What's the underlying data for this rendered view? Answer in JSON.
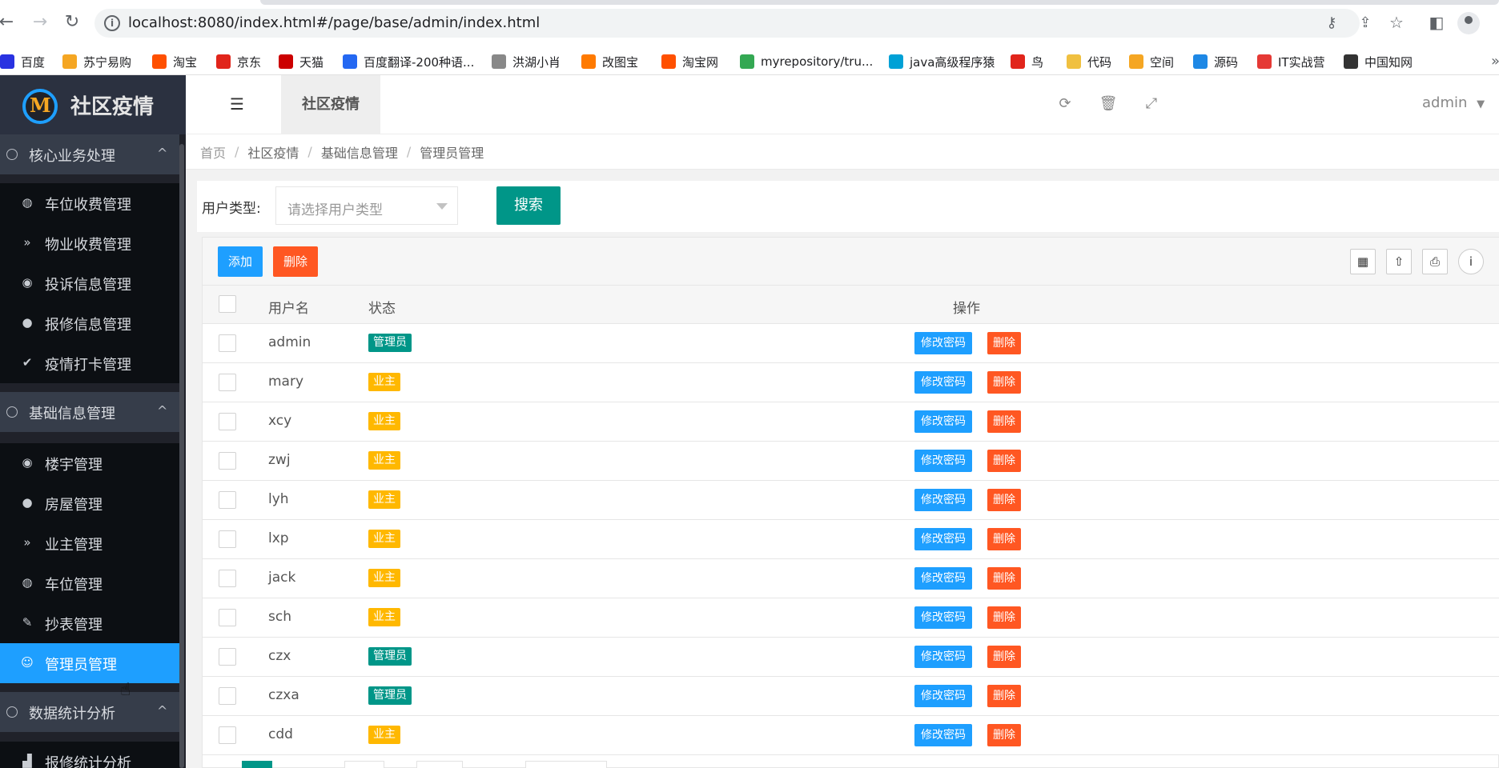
{
  "browser": {
    "url": "localhost:8080/index.html#/page/base/admin/index.html",
    "bookmarks": [
      {
        "label": "百度",
        "icon": "baidu-paw-icon",
        "color": "#2932e1"
      },
      {
        "label": "苏宁易购",
        "icon": "suning-lion-icon",
        "color": "#f5a623"
      },
      {
        "label": "淘宝",
        "icon": "taobao-icon",
        "color": "#ff5000"
      },
      {
        "label": "京东",
        "icon": "jd-icon",
        "color": "#e1251b"
      },
      {
        "label": "天猫",
        "icon": "tmall-icon",
        "color": "#cc0000"
      },
      {
        "label": "百度翻译-200种语...",
        "icon": "baidu-translate-icon",
        "color": "#2468f2"
      },
      {
        "label": "洪湖小肖",
        "icon": "bird-icon",
        "color": "#888888"
      },
      {
        "label": "改图宝",
        "icon": "gaitubao-icon",
        "color": "#ff7a00"
      },
      {
        "label": "淘宝网",
        "icon": "taobao-net-icon",
        "color": "#ff5000"
      },
      {
        "label": "myrepository/tru...",
        "icon": "chrome-site-icon",
        "color": "#34a853"
      },
      {
        "label": "java高级程序猿",
        "icon": "bilibili-icon",
        "color": "#00a1d6"
      },
      {
        "label": "鸟",
        "icon": "bird-red-icon",
        "color": "#e1251b"
      },
      {
        "label": "代码",
        "icon": "code-icon",
        "color": "#f0c040"
      },
      {
        "label": "空间",
        "icon": "qzone-icon",
        "color": "#f5a623"
      },
      {
        "label": "源码",
        "icon": "source-fish-icon",
        "color": "#1e88e5"
      },
      {
        "label": "IT实战营",
        "icon": "it-camp-icon",
        "color": "#e53935"
      },
      {
        "label": "中国知网",
        "icon": "cnki-icon",
        "color": "#333333"
      }
    ]
  },
  "app": {
    "logo_text": "社区疫情",
    "top_tab": "社区疫情",
    "user": "admin"
  },
  "sidebar": {
    "groups": [
      {
        "label": "核心业务处理",
        "chevron": "^"
      },
      {
        "label": "基础信息管理",
        "chevron": "^"
      },
      {
        "label": "数据统计分析",
        "chevron": "^"
      }
    ],
    "items": [
      {
        "label": "车位收费管理",
        "icon": "dashboard-icon",
        "glyph": "◍"
      },
      {
        "label": "物业收费管理",
        "icon": "double-chevron-down-icon",
        "glyph": "»"
      },
      {
        "label": "投诉信息管理",
        "icon": "target-icon",
        "glyph": "◉"
      },
      {
        "label": "报修信息管理",
        "icon": "repair-icon",
        "glyph": "●"
      },
      {
        "label": "疫情打卡管理",
        "icon": "check-icon",
        "glyph": "✔"
      },
      {
        "label": "楼宇管理",
        "icon": "target-icon",
        "glyph": "◉"
      },
      {
        "label": "房屋管理",
        "icon": "house-icon",
        "glyph": "●"
      },
      {
        "label": "业主管理",
        "icon": "double-chevron-down-icon",
        "glyph": "»"
      },
      {
        "label": "车位管理",
        "icon": "dashboard-icon",
        "glyph": "◍"
      },
      {
        "label": "抄表管理",
        "icon": "edit-icon",
        "glyph": "✎"
      },
      {
        "label": "管理员管理",
        "icon": "user-circle-icon",
        "glyph": "☺"
      },
      {
        "label": "报修统计分析",
        "icon": "chart-icon",
        "glyph": "▟"
      }
    ]
  },
  "breadcrumb": [
    "首页",
    "社区疫情",
    "基础信息管理",
    "管理员管理"
  ],
  "search": {
    "label": "用户类型:",
    "placeholder": "请选择用户类型",
    "button": "搜索"
  },
  "toolbar": {
    "add": "添加",
    "delete": "删除"
  },
  "table": {
    "headers": {
      "username": "用户名",
      "status": "状态",
      "actions": "操作"
    },
    "action_labels": {
      "change_password": "修改密码",
      "delete": "删除"
    },
    "rows": [
      {
        "username": "admin",
        "status": "管理员",
        "type": "admin"
      },
      {
        "username": "mary",
        "status": "业主",
        "type": "owner"
      },
      {
        "username": "xcy",
        "status": "业主",
        "type": "owner"
      },
      {
        "username": "zwj",
        "status": "业主",
        "type": "owner"
      },
      {
        "username": "lyh",
        "status": "业主",
        "type": "owner"
      },
      {
        "username": "lxp",
        "status": "业主",
        "type": "owner"
      },
      {
        "username": "jack",
        "status": "业主",
        "type": "owner"
      },
      {
        "username": "sch",
        "status": "业主",
        "type": "owner"
      },
      {
        "username": "czx",
        "status": "管理员",
        "type": "admin"
      },
      {
        "username": "czxa",
        "status": "管理员",
        "type": "admin"
      },
      {
        "username": "cdd",
        "status": "业主",
        "type": "owner"
      }
    ]
  }
}
